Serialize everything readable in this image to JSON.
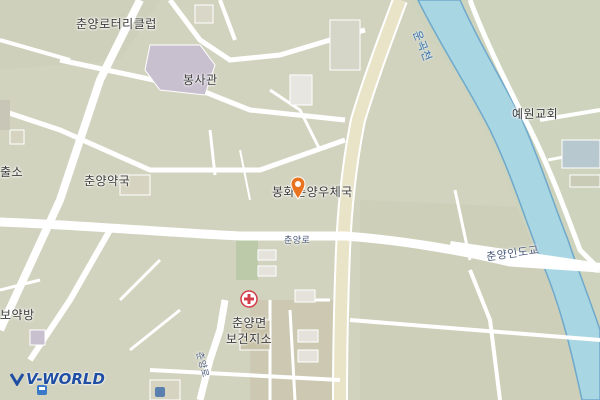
{
  "map": {
    "labels": {
      "rotary_club": "춘양로터리클럽",
      "bongsagwan": "봉사관",
      "yewon_church": "예원교회",
      "pharmacy": "춘양약국",
      "post_office": "봉화춘양우체국",
      "road": "춘양로",
      "bridge": "춘양인도교",
      "river": "운곡천",
      "health_center_line1": "춘양면",
      "health_center_line2": "보건지소",
      "left_edge_1": "출소",
      "left_edge_2": "보약방",
      "road_vertical": "춘양로"
    },
    "icons": {
      "selected": "location-pin-icon",
      "health_center": "hospital-cross-icon"
    },
    "logo_text": "V-WORLD",
    "colors": {
      "land": "#d2d3bf",
      "road": "#ffffff",
      "main_road": "#e9e4c8",
      "river": "#a9d6e3",
      "river_bank": "#3d86b8",
      "pin": "#e9731e",
      "building": "#c9bcc9"
    }
  }
}
